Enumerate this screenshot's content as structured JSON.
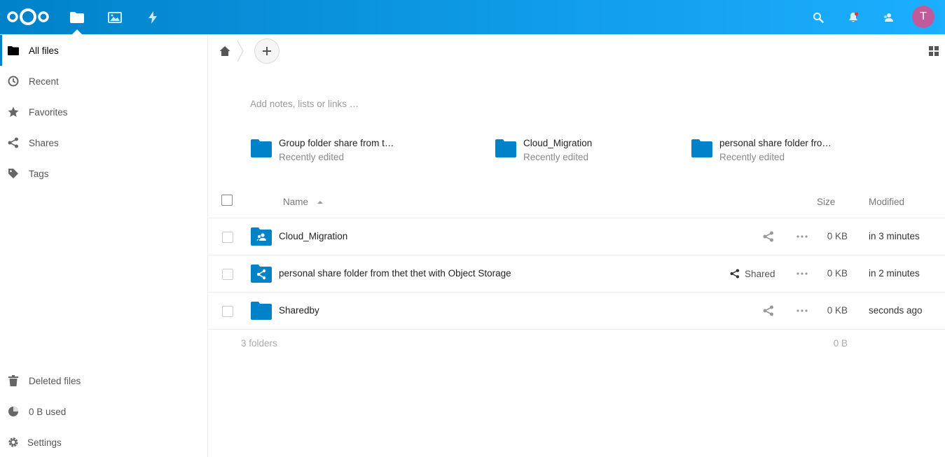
{
  "header": {
    "apps": [
      {
        "name": "files-icon",
        "active": true
      },
      {
        "name": "photos-icon",
        "active": false
      },
      {
        "name": "activity-icon",
        "active": false
      }
    ],
    "avatar_letter": "T",
    "accent": "#0082c9"
  },
  "sidebar": {
    "items": [
      {
        "label": "All files",
        "icon": "folder-icon",
        "active": true
      },
      {
        "label": "Recent",
        "icon": "clock-icon"
      },
      {
        "label": "Favorites",
        "icon": "star-icon"
      },
      {
        "label": "Shares",
        "icon": "share-icon"
      },
      {
        "label": "Tags",
        "icon": "tag-icon"
      }
    ],
    "bottom": [
      {
        "label": "Deleted files",
        "icon": "trash-icon"
      },
      {
        "label": "0 B used",
        "icon": "quota-icon"
      },
      {
        "label": "Settings",
        "icon": "gear-icon"
      }
    ]
  },
  "main": {
    "notes_placeholder": "Add notes, lists or links …",
    "recent": [
      {
        "name": "Group folder share from t…",
        "sub": "Recently edited"
      },
      {
        "name": "Cloud_Migration",
        "sub": "Recently edited"
      },
      {
        "name": "personal share folder fro…",
        "sub": "Recently edited"
      }
    ],
    "table": {
      "col_name": "Name",
      "col_size": "Size",
      "col_modified": "Modified",
      "rows": [
        {
          "name": "Cloud_Migration",
          "icon": "group-folder-icon",
          "shared_label": "",
          "size": "0 KB",
          "modified": "in 3 minutes"
        },
        {
          "name": "personal share folder from thet thet with Object Storage",
          "icon": "shared-folder-icon",
          "shared_label": "Shared",
          "size": "0 KB",
          "modified": "in 2 minutes"
        },
        {
          "name": "Sharedby",
          "icon": "folder-icon",
          "shared_label": "",
          "size": "0 KB",
          "modified": "seconds ago"
        }
      ],
      "summary_count": "3 folders",
      "summary_size": "0 B"
    }
  }
}
